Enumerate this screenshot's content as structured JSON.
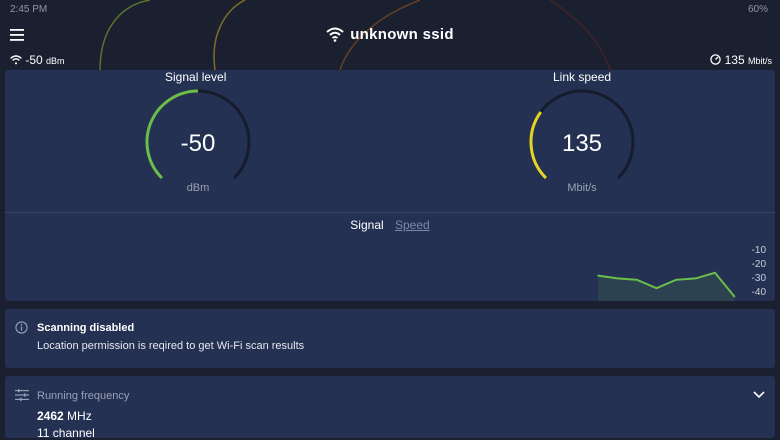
{
  "status_bar": {
    "time": "2:45 PM",
    "battery": "60%"
  },
  "app_bar": {
    "title": "unknown ssid",
    "signal_readout_value": "-50",
    "signal_readout_unit": "dBm",
    "speed_readout_value": "135",
    "speed_readout_unit": "Mbit/s"
  },
  "gauges": {
    "signal": {
      "label": "Signal level",
      "value": "-50",
      "unit": "dBm",
      "fraction": 0.5,
      "color": "#6abf4b"
    },
    "speed": {
      "label": "Link speed",
      "value": "135",
      "unit": "Mbit/s",
      "fraction": 0.3,
      "color": "#e5d424"
    }
  },
  "chart_tabs": {
    "active": "Signal",
    "inactive": "Speed"
  },
  "chart_data": {
    "type": "area",
    "y_tick_labels": [
      "-10",
      "-20",
      "-30",
      "-40"
    ],
    "ylim": [
      -45,
      -5
    ],
    "series": [
      {
        "values": [
          -29,
          -31,
          -32,
          -38,
          -32,
          -31,
          -27,
          -44
        ]
      }
    ],
    "color": "#6abf4b"
  },
  "info": {
    "title": "Scanning disabled",
    "body": "Location permission is reqired to get Wi-Fi scan results"
  },
  "frequency": {
    "title": "Running frequency",
    "value": "2462",
    "unit": "MHz",
    "channel": "11 channel"
  },
  "colors": {
    "background": "#1b2030",
    "card": "#253152",
    "accent_green": "#6abf4b",
    "accent_yellow": "#e5d424"
  }
}
